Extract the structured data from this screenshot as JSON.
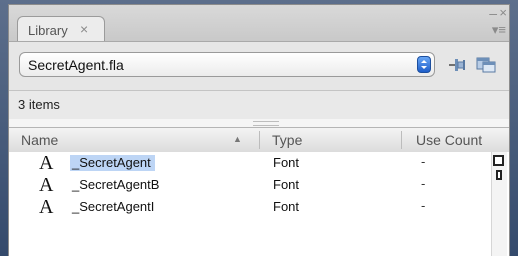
{
  "panel": {
    "tab_label": "Library",
    "tab_close_glyph": "×",
    "window_minimize_glyph": "–",
    "window_close_glyph": "×",
    "panel_menu_glyph": "▾≡"
  },
  "toolbar": {
    "document_select_value": "SecretAgent.fla",
    "pin_icon": "pin-library-icon",
    "new_library_icon": "new-library-panel-icon"
  },
  "status": {
    "item_count": "3 items"
  },
  "columns": {
    "name": "Name",
    "type": "Type",
    "use_count": "Use Count",
    "sort_indicator": "▲"
  },
  "items": [
    {
      "icon": "font-symbol-icon",
      "icon_glyph": "A",
      "name": "_SecretAgent",
      "type": "Font",
      "use_count": "-",
      "selected": true
    },
    {
      "icon": "font-symbol-icon",
      "icon_glyph": "A",
      "name": "_SecretAgentB",
      "type": "Font",
      "use_count": "-",
      "selected": false
    },
    {
      "icon": "font-symbol-icon",
      "icon_glyph": "A",
      "name": "_SecretAgentI",
      "type": "Font",
      "use_count": "-",
      "selected": false
    }
  ],
  "colors": {
    "selection": "#bdd5f5",
    "stepper_blue": "#2f72d8"
  }
}
